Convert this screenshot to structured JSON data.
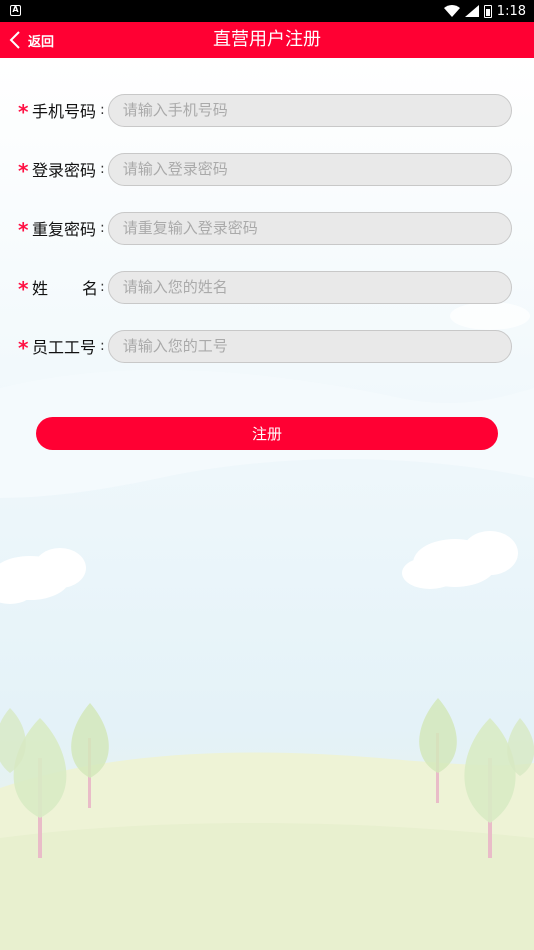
{
  "status_bar": {
    "left_icon": "A",
    "time": "1:18",
    "icons": [
      "wifi-icon",
      "signal-icon",
      "battery-icon"
    ]
  },
  "nav": {
    "back_label": "返回",
    "title": "直营用户注册"
  },
  "form": {
    "required_mark": "*",
    "colon": ":",
    "fields": [
      {
        "label": "手机号码",
        "placeholder": "请输入手机号码",
        "value": ""
      },
      {
        "label": "登录密码",
        "placeholder": "请输入登录密码",
        "value": ""
      },
      {
        "label": "重复密码",
        "placeholder": "请重复输入登录密码",
        "value": ""
      },
      {
        "label_chars": [
          "姓",
          "名"
        ],
        "placeholder": "请输入您的姓名",
        "value": ""
      },
      {
        "label": "员工工号",
        "placeholder": "请输入您的工号",
        "value": ""
      }
    ]
  },
  "register_label": "注册",
  "colors": {
    "accent": "#ff0033",
    "status_bar": "#000000",
    "input_bg": "#e9e9e9",
    "required_star": "#ff1144"
  }
}
